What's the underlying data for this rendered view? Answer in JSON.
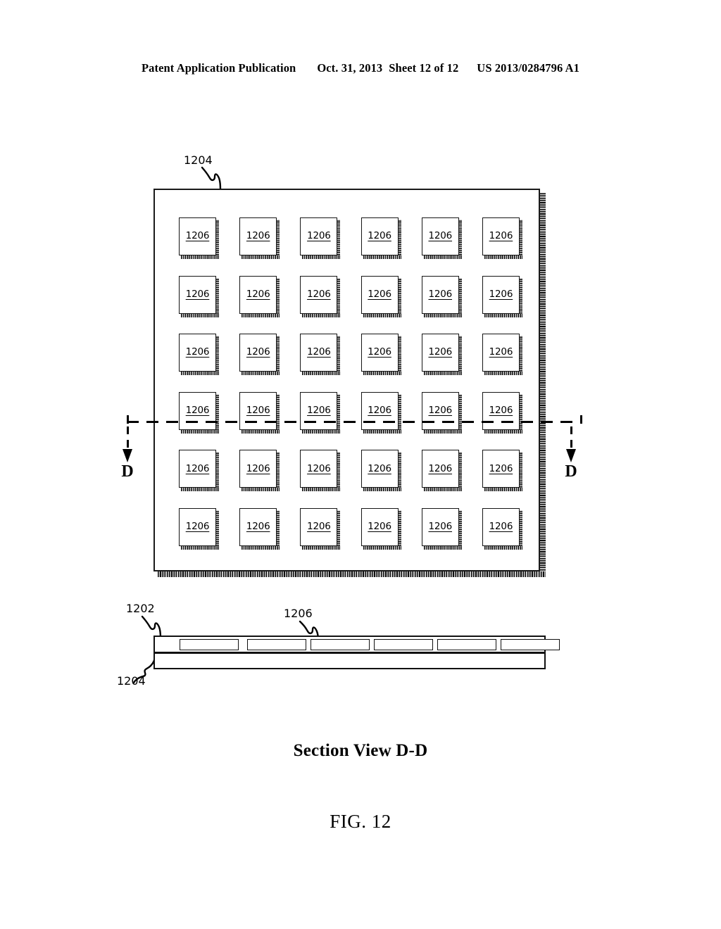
{
  "header": {
    "publication": "Patent Application Publication",
    "date": "Oct. 31, 2013",
    "sheet": "Sheet 12 of 12",
    "patent_number": "US 2013/0284796 A1"
  },
  "figure": {
    "caption": "FIG. 12",
    "section_caption": "Section View D-D",
    "section_marker_left": "D",
    "section_marker_right": "D"
  },
  "plan_view": {
    "panel_ref": "1204",
    "grid": {
      "rows": 6,
      "columns": 6,
      "cell_ref": "1206",
      "cells": [
        [
          "1206",
          "1206",
          "1206",
          "1206",
          "1206",
          "1206"
        ],
        [
          "1206",
          "1206",
          "1206",
          "1206",
          "1206",
          "1206"
        ],
        [
          "1206",
          "1206",
          "1206",
          "1206",
          "1206",
          "1206"
        ],
        [
          "1206",
          "1206",
          "1206",
          "1206",
          "1206",
          "1206"
        ],
        [
          "1206",
          "1206",
          "1206",
          "1206",
          "1206",
          "1206"
        ],
        [
          "1206",
          "1206",
          "1206",
          "1206",
          "1206",
          "1206"
        ]
      ]
    }
  },
  "section_view": {
    "top_layer_ref": "1202",
    "bottom_layer_ref": "1204",
    "cell_ref": "1206",
    "cell_count": 6
  },
  "colors": {
    "ink": "#000000",
    "line": "#111111",
    "background": "#ffffff",
    "shadow_stipple_dark": "#0d0d0d",
    "shadow_stipple_light": "#cfcfcf"
  }
}
